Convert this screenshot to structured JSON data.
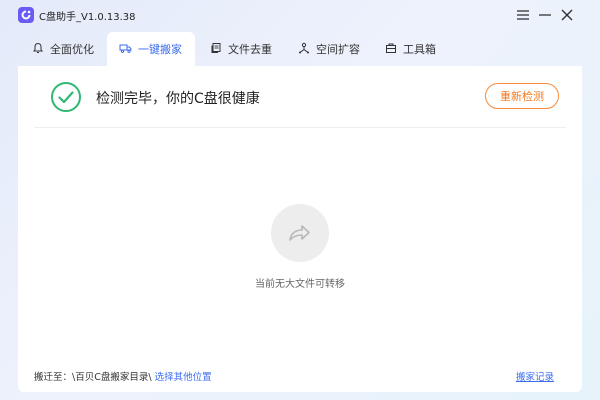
{
  "app": {
    "title": "C盘助手_V1.0.13.38",
    "icon": "app-logo-icon"
  },
  "window_controls": {
    "menu_icon": "menu-icon",
    "minimize_icon": "minimize-icon",
    "close_icon": "close-icon"
  },
  "tabs": [
    {
      "label": "全面优化",
      "icon": "bell-icon",
      "active": false
    },
    {
      "label": "一键搬家",
      "icon": "truck-icon",
      "active": true
    },
    {
      "label": "文件去重",
      "icon": "files-icon",
      "active": false
    },
    {
      "label": "空间扩容",
      "icon": "expand-icon",
      "active": false
    },
    {
      "label": "工具箱",
      "icon": "toolbox-icon",
      "active": false
    }
  ],
  "status": {
    "text": "检测完毕，你的C盘很健康",
    "icon": "check-circle-icon",
    "recheck_label": "重新检测"
  },
  "empty_state": {
    "icon": "share-arrow-icon",
    "text": "当前无大文件可转移"
  },
  "footer": {
    "move_to_label": "搬迁至：",
    "move_to_path": "\\百贝C盘搬家目录\\",
    "choose_location_label": "选择其他位置",
    "history_label": "搬家记录"
  },
  "colors": {
    "accent": "#3c6cf0",
    "success": "#2eb872",
    "warning": "#f07a22"
  }
}
